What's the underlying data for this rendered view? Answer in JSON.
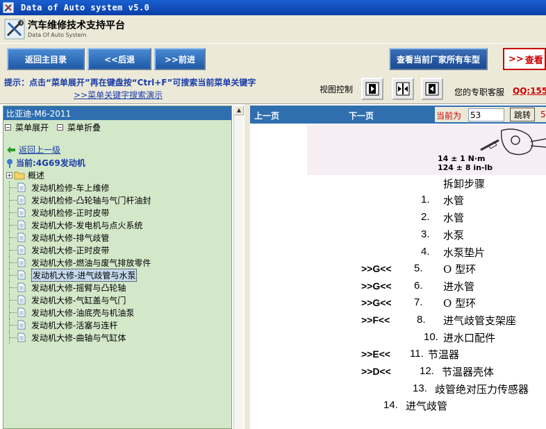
{
  "window": {
    "title": "Data of Auto system v5.0"
  },
  "header": {
    "title_cn": "汽车维修技术支持平台",
    "title_en": "Data Of Auto System"
  },
  "toolbar": {
    "home_label": "返回主目录",
    "back_label": "<<后退",
    "forward_label": ">>前进",
    "all_models_label": "查看当前厂家所有车型",
    "view_label": "查看"
  },
  "hint": {
    "text": "提示：点击“菜单展开”再在键盘按“Ctrl+F”可搜索当前菜单关键字",
    "link": ">>菜单关键字搜索演示",
    "view_control": "视图控制",
    "service_label": "您的专职客服",
    "service_qq": "QQ:155"
  },
  "tree": {
    "header": "比亚迪-M6-2011",
    "expand_label": "菜单展开",
    "collapse_label": "菜单折叠",
    "back_label": "返回上一级",
    "current_label": "当前:4G69发动机",
    "folder_label": "概述",
    "items": [
      "发动机检修-车上维修",
      "发动机检修-凸轮轴与气门杆油封",
      "发动机检修-正时皮带",
      "发动机大修-发电机与点火系统",
      "发动机大修-排气歧管",
      "发动机大修-正时皮带",
      "发动机大修-燃油与废气排放零件",
      "发动机大修-进气歧管与水泵",
      "发动机大修-摇臂与凸轮轴",
      "发动机大修-气缸盖与气门",
      "发动机大修-油底壳与机油泵",
      "发动机大修-活塞与连杆",
      "发动机大修-曲轴与气缸体"
    ],
    "selected_index": 7
  },
  "nav": {
    "prev_label": "上一页",
    "next_label": "下一页",
    "current_label": "当前为",
    "page_value": "53",
    "jump_label": "跳转",
    "tail": "5"
  },
  "doc": {
    "torque_nm": "14 ± 1 N·m",
    "torque_inlb": "124 ± 8 in-lb",
    "steps_title": "拆卸步骤",
    "steps": [
      {
        "code": "",
        "num": "1.",
        "name": "水管"
      },
      {
        "code": "",
        "num": "2.",
        "name": "水管"
      },
      {
        "code": "",
        "num": "3.",
        "name": "水泵"
      },
      {
        "code": "",
        "num": "4.",
        "name": "水泵垫片"
      },
      {
        "code": ">>G<<",
        "num": "5.",
        "name": "O 型环"
      },
      {
        "code": ">>G<<",
        "num": "6.",
        "name": "进水管"
      },
      {
        "code": ">>G<<",
        "num": "7.",
        "name": "O 型环"
      },
      {
        "code": ">>F<<",
        "num": "8.",
        "name": "进气歧管支架座"
      },
      {
        "code": "",
        "num": "10.",
        "name": "进水口配件"
      },
      {
        "code": ">>E<<",
        "num": "11.",
        "name": "节温器"
      },
      {
        "code": ">>D<<",
        "num": "12.",
        "name": "节温器壳体"
      },
      {
        "code": "",
        "num": "13.",
        "name": "歧管绝对压力传感器"
      },
      {
        "code": "",
        "num": "14.",
        "name": "进气歧管"
      }
    ]
  }
}
